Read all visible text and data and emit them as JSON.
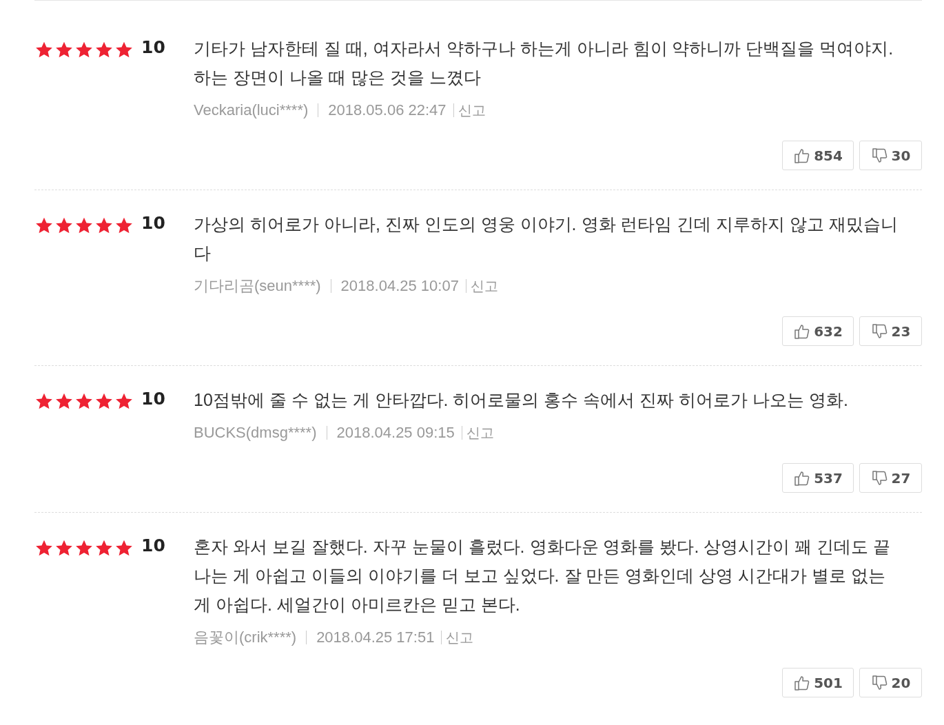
{
  "reviews": [
    {
      "stars": 5,
      "score": "10",
      "text": "기타가 남자한테 질 때, 여자라서 약하구나 하는게 아니라 힘이 약하니까 단백질을 먹여야지. 하는 장면이 나올 때 많은 것을 느꼈다",
      "author": "Veckaria(luci****)",
      "date": "2018.05.06 22:47",
      "report": "신고",
      "likes": "854",
      "dislikes": "30"
    },
    {
      "stars": 5,
      "score": "10",
      "text": "가상의 히어로가 아니라, 진짜 인도의 영웅 이야기. 영화 런타임 긴데 지루하지 않고 재밌습니다",
      "author": "기다리곰(seun****)",
      "date": "2018.04.25 10:07",
      "report": "신고",
      "likes": "632",
      "dislikes": "23"
    },
    {
      "stars": 5,
      "score": "10",
      "text": "10점밖에 줄 수 없는 게 안타깝다. 히어로물의 홍수 속에서 진짜 히어로가 나오는 영화.",
      "author": "BUCKS(dmsg****)",
      "date": "2018.04.25 09:15",
      "report": "신고",
      "likes": "537",
      "dislikes": "27"
    },
    {
      "stars": 5,
      "score": "10",
      "text": "혼자 와서 보길 잘했다. 자꾸 눈물이 흘렀다. 영화다운 영화를 봤다. 상영시간이 꽤 긴데도 끝나는 게 아쉽고 이들의 이야기를 더 보고 싶었다. 잘 만든 영화인데 상영 시간대가 별로 없는 게 아쉽다. 세얼간이 아미르칸은 믿고 본다.",
      "author": "음꽃이(crik****)",
      "date": "2018.04.25 17:51",
      "report": "신고",
      "likes": "501",
      "dislikes": "20"
    }
  ]
}
